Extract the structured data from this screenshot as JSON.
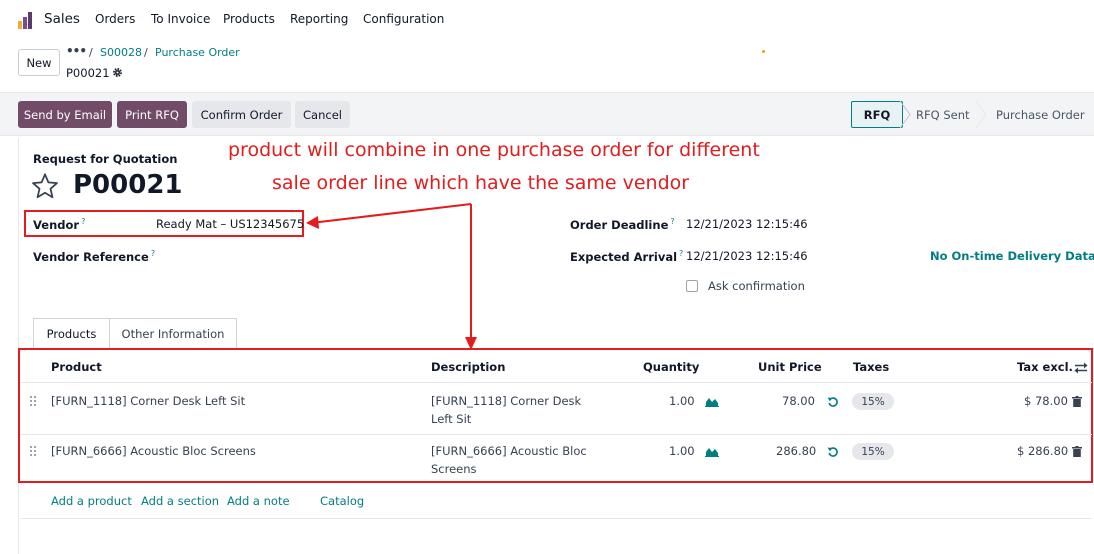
{
  "nav": {
    "brand": "Sales",
    "items": [
      "Orders",
      "To Invoice",
      "Products",
      "Reporting",
      "Configuration"
    ]
  },
  "control": {
    "new_label": "New",
    "breadcrumb_dots": "•••",
    "sep": "/",
    "breadcrumb": [
      "S00028",
      "Purchase Order"
    ],
    "record_name": "P00021"
  },
  "actions": {
    "send_email": "Send by Email",
    "print_rfq": "Print RFQ",
    "confirm": "Confirm Order",
    "cancel": "Cancel"
  },
  "statusbar": {
    "stages": [
      "RFQ",
      "RFQ Sent",
      "Purchase Order"
    ],
    "current": "RFQ"
  },
  "form": {
    "subtitle": "Request for Quotation",
    "title": "P00021",
    "vendor_label": "Vendor",
    "vendor_value": "Ready Mat – US12345675",
    "vendor_ref_label": "Vendor Reference",
    "order_deadline_label": "Order Deadline",
    "order_deadline_value": "12/21/2023 12:15:46",
    "expected_arrival_label": "Expected Arrival",
    "expected_arrival_value": "12/21/2023 12:15:46",
    "on_time_label": "No On-time Delivery Data",
    "ask_confirmation_label": "Ask confirmation",
    "help_mark": "?"
  },
  "annotation": {
    "line1": "product will combine in one purchase order for different",
    "line2": "sale order line which have the same vendor",
    "color": "#e11d1d"
  },
  "tabs": [
    "Products",
    "Other Information"
  ],
  "table": {
    "headers": {
      "product": "Product",
      "description": "Description",
      "quantity": "Quantity",
      "unit_price": "Unit Price",
      "taxes": "Taxes",
      "tax_excl": "Tax excl."
    },
    "rows": [
      {
        "product": "[FURN_1118] Corner Desk Left Sit",
        "description": "[FURN_1118] Corner Desk Left Sit",
        "quantity": "1.00",
        "unit_price": "78.00",
        "tax": "15%",
        "subtotal": "$ 78.00"
      },
      {
        "product": "[FURN_6666] Acoustic Bloc Screens",
        "description": "[FURN_6666] Acoustic Bloc Screens",
        "quantity": "1.00",
        "unit_price": "286.80",
        "tax": "15%",
        "subtotal": "$ 286.80"
      }
    ]
  },
  "footer": {
    "add_product": "Add a product",
    "add_section": "Add a section",
    "add_note": "Add a note",
    "catalog": "Catalog"
  },
  "icons": {
    "app": "sales-app-icon",
    "gear": "gear-icon",
    "star": "star-icon",
    "handle": "drag-handle-icon",
    "forecast": "area-chart-icon",
    "reset": "undo-icon",
    "delete": "trash-icon",
    "columns": "optional-columns-icon"
  },
  "colors": {
    "brand": "#714b67",
    "teal": "#017e84",
    "annotation_red": "#e31d1d"
  }
}
